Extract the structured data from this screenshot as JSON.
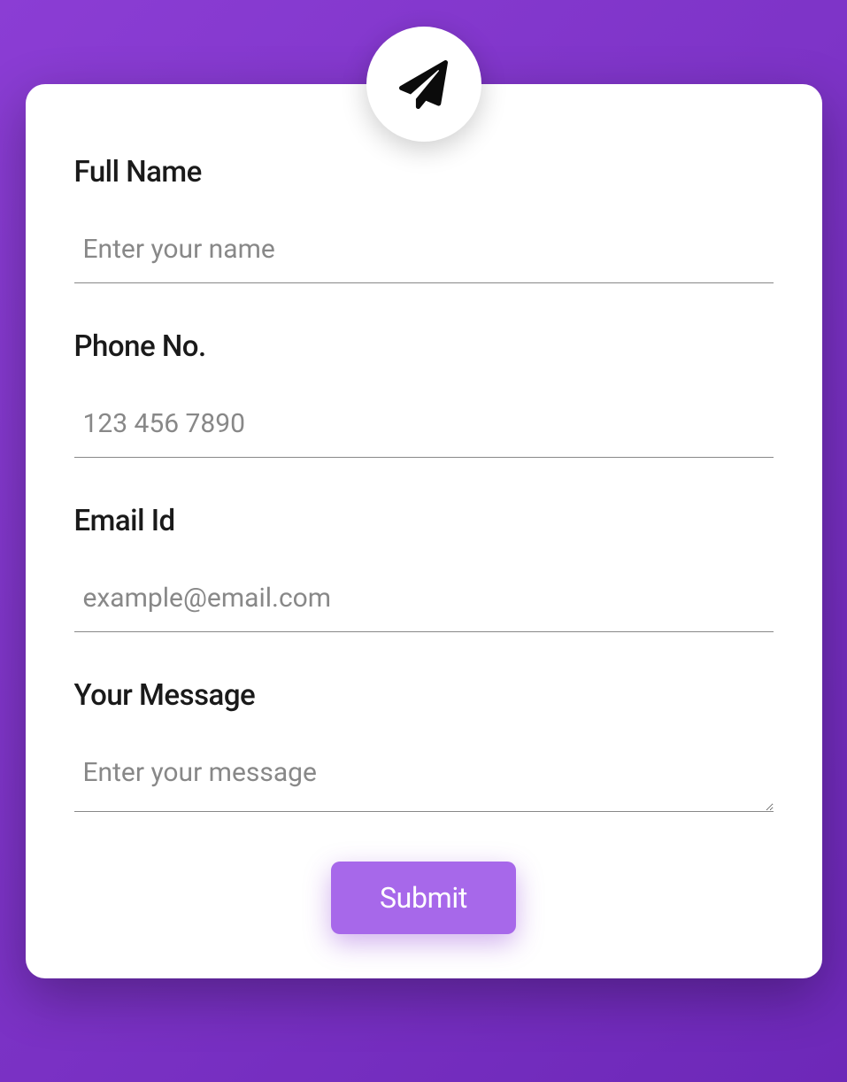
{
  "form": {
    "fields": {
      "fullName": {
        "label": "Full Name",
        "placeholder": "Enter your name"
      },
      "phone": {
        "label": "Phone No.",
        "placeholder": "123 456 7890"
      },
      "email": {
        "label": "Email Id",
        "placeholder": "example@email.com"
      },
      "message": {
        "label": "Your Message",
        "placeholder": "Enter your message"
      }
    },
    "submit_label": "Submit"
  }
}
